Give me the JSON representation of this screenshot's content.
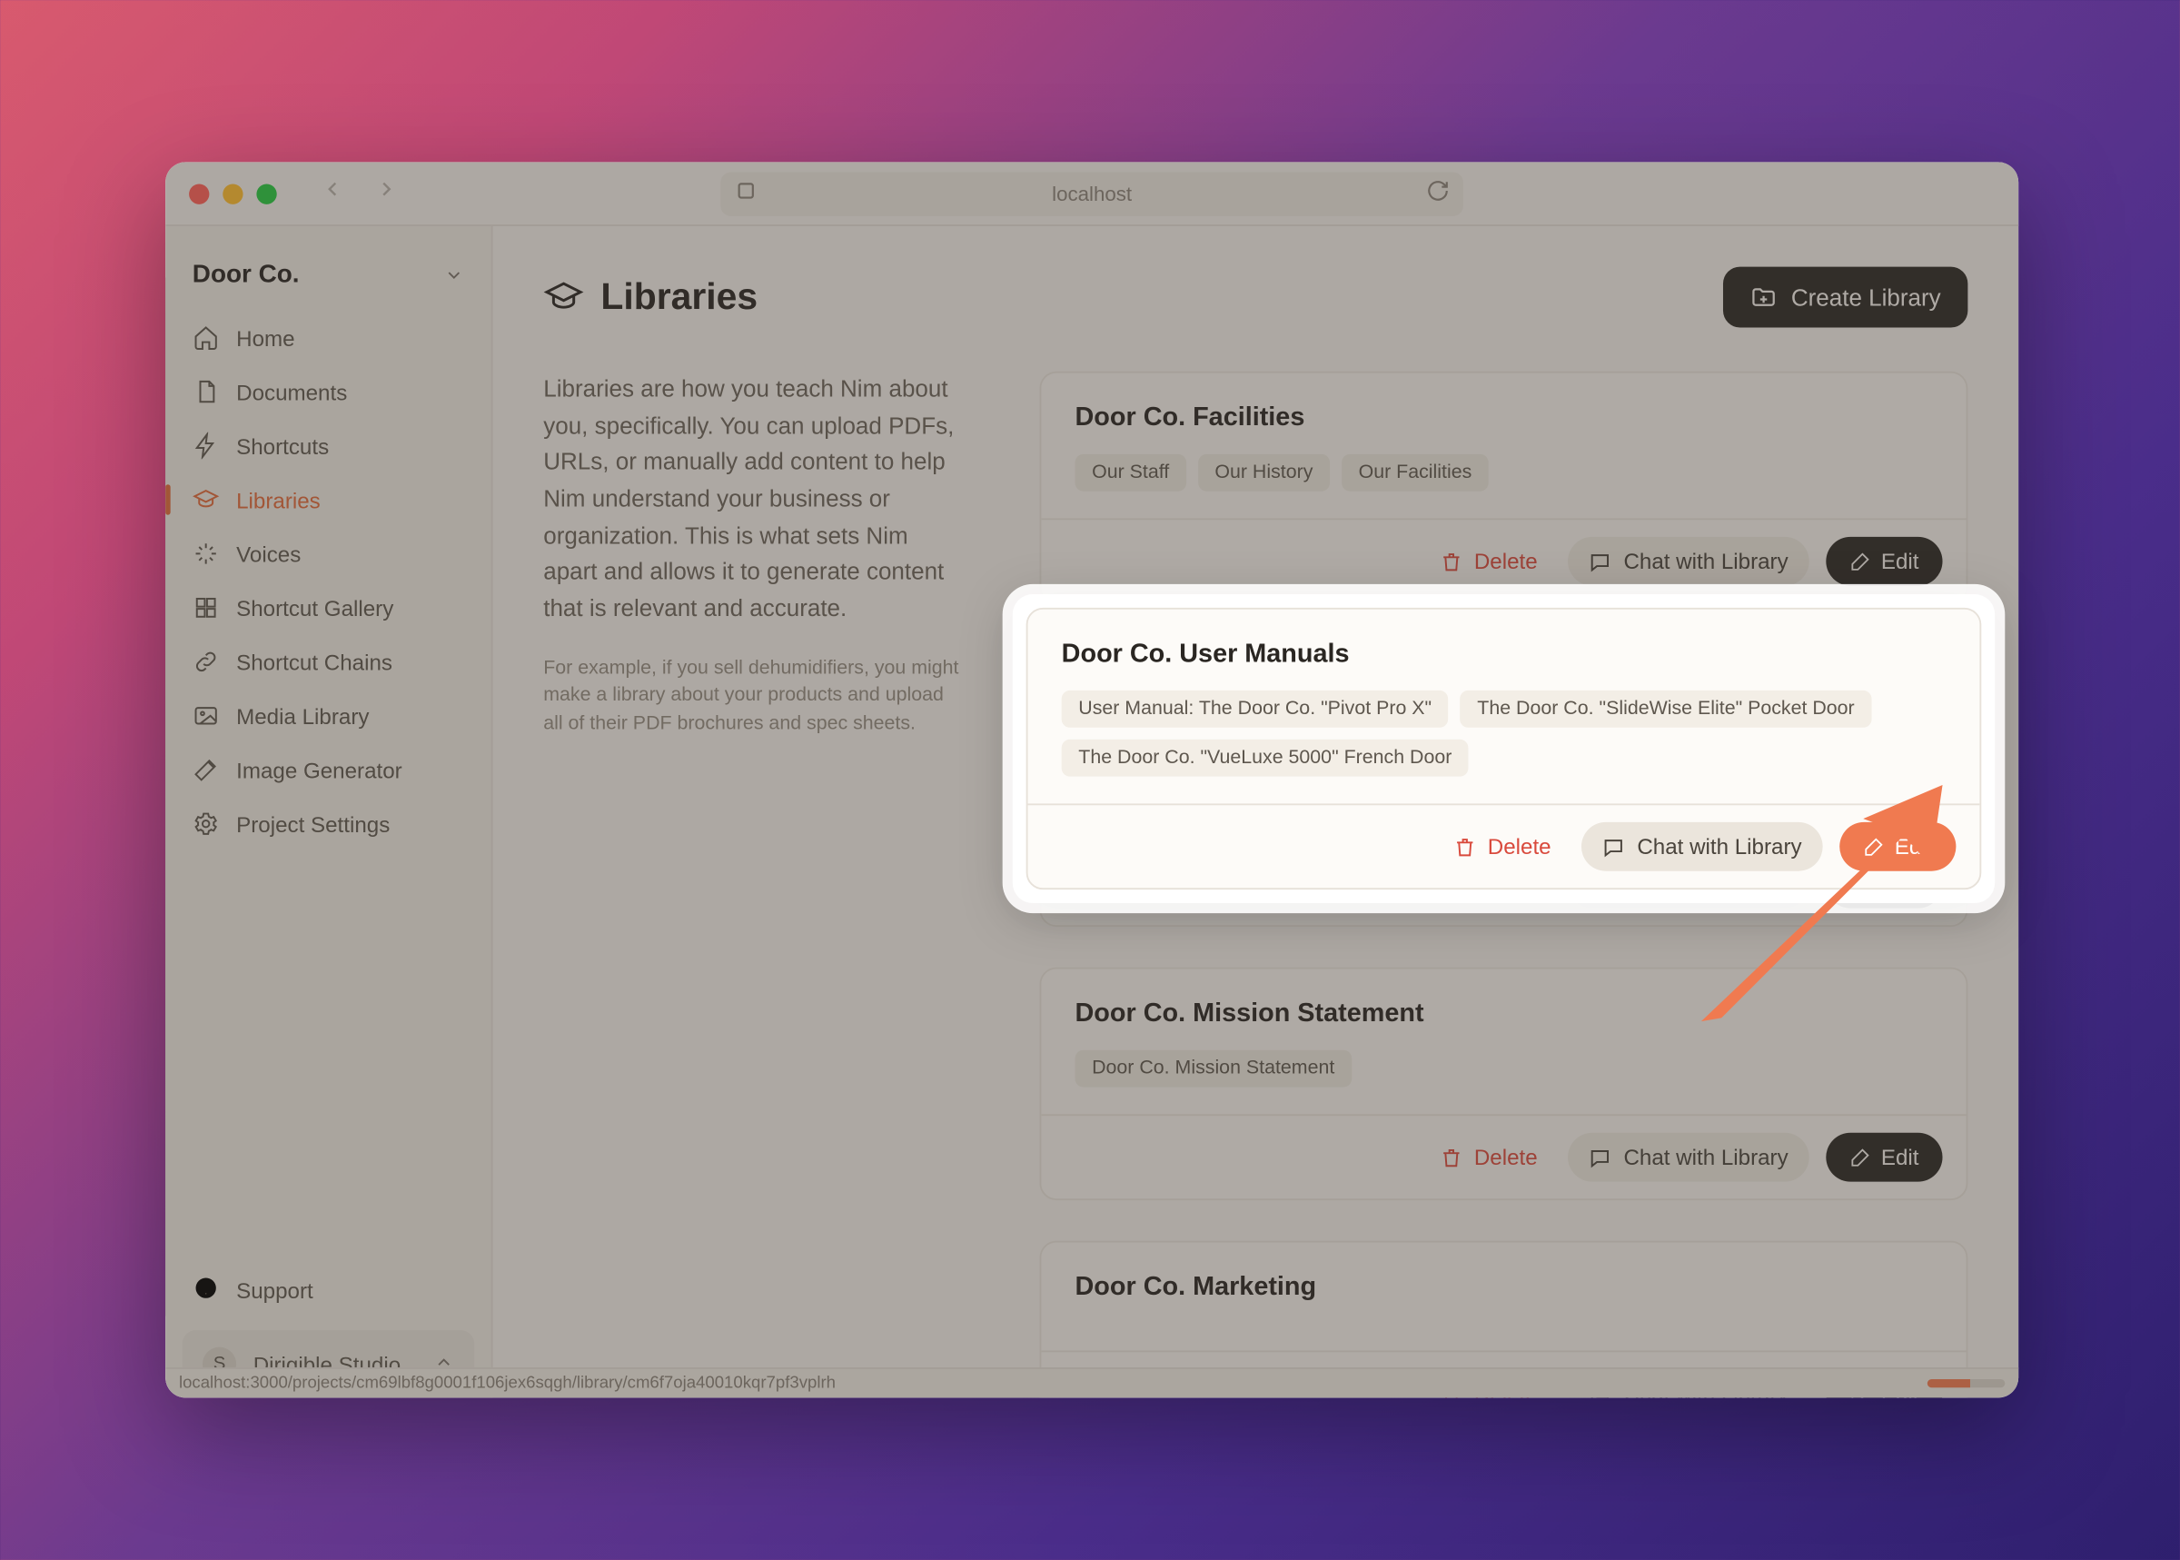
{
  "browser": {
    "url": "localhost",
    "status_url": "localhost:3000/projects/cm69lbf8g0001f106jex6sqgh/library/cm6f7oja40010kqr7pf3vplrh"
  },
  "sidebar": {
    "project_name": "Door Co.",
    "items": [
      {
        "label": "Home",
        "icon": "home-icon"
      },
      {
        "label": "Documents",
        "icon": "document-icon"
      },
      {
        "label": "Shortcuts",
        "icon": "bolt-icon"
      },
      {
        "label": "Libraries",
        "icon": "grad-cap-icon",
        "active": true
      },
      {
        "label": "Voices",
        "icon": "sparkle-icon"
      },
      {
        "label": "Shortcut Gallery",
        "icon": "grid-icon"
      },
      {
        "label": "Shortcut Chains",
        "icon": "link-icon"
      },
      {
        "label": "Media Library",
        "icon": "image-icon"
      },
      {
        "label": "Image Generator",
        "icon": "wand-icon"
      },
      {
        "label": "Project Settings",
        "icon": "gear-icon"
      }
    ],
    "support_label": "Support",
    "workspace_name": "Dirigible Studio",
    "workspace_initial": "S"
  },
  "page": {
    "title": "Libraries",
    "create_label": "Create Library",
    "intro": "Libraries are how you teach Nim about you, specifically. You can upload PDFs, URLs, or manually add content to help Nim understand your business or organization. This is what sets Nim apart and allows it to generate content that is relevant and accurate.",
    "intro_example": "For example, if you sell dehumidifiers, you might make a library about your products and upload all of their PDF brochures and spec sheets."
  },
  "actions": {
    "delete": "Delete",
    "chat": "Chat with Library",
    "edit": "Edit"
  },
  "libraries": [
    {
      "title": "Door Co. Facilities",
      "tags": [
        "Our Staff",
        "Our History",
        "Our Facilities"
      ]
    },
    {
      "title": "Door Co. User Manuals",
      "tags": [
        "User Manual: The Door Co. \"Pivot Pro X\"",
        "The Door Co. \"SlideWise Elite\" Pocket Door",
        "The Door Co. \"VueLuxe 5000\" French Door"
      ],
      "highlighted": true
    },
    {
      "title": "Door Co. Mission Statement",
      "tags": [
        "Door Co. Mission Statement"
      ]
    },
    {
      "title": "Door Co. Marketing",
      "tags": []
    }
  ]
}
